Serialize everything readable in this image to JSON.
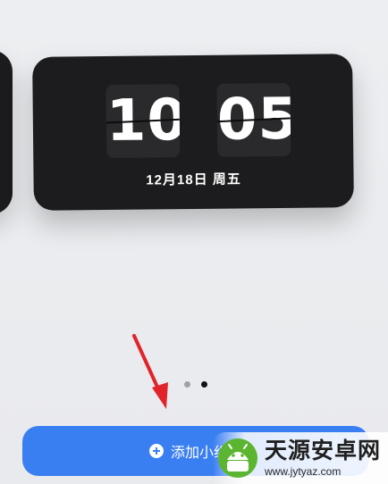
{
  "clock": {
    "hours": "10",
    "minutes": "05",
    "date": "12月18日 周五"
  },
  "pagination": {
    "total": 2,
    "active": 2
  },
  "add_button": {
    "label": "添加小组件"
  },
  "watermark": {
    "title": "天源安卓网",
    "url": "www.jytyaz.com"
  },
  "colors": {
    "button": "#3a7ff2",
    "widget": "#1c1c1e",
    "arrow": "#e0242a",
    "background": "#edeef0"
  }
}
